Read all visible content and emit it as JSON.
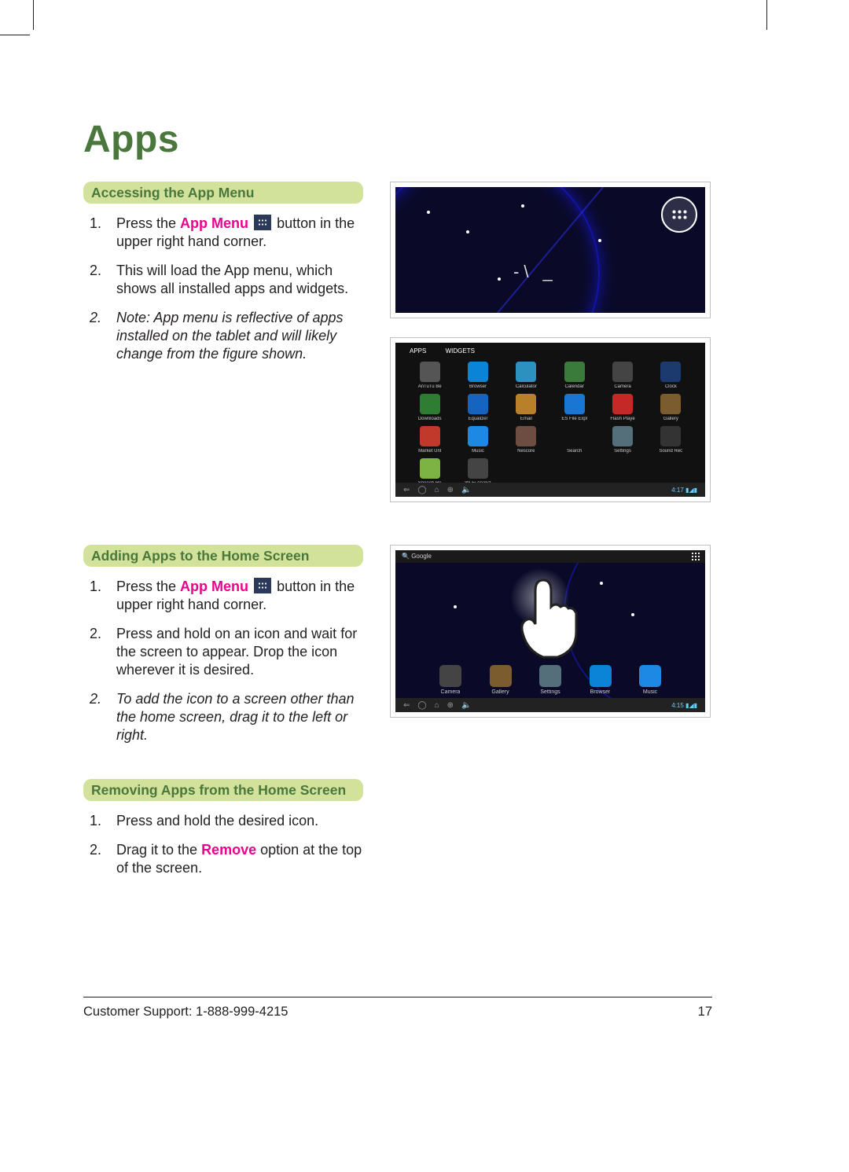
{
  "page": {
    "title": "Apps",
    "number": "17",
    "footer": "Customer Support: 1-888-999-4215"
  },
  "sections": {
    "accessing": {
      "heading": "Accessing the App Menu",
      "step1_a": "Press the ",
      "step1_b": "App Menu",
      "step1_c": " button in the upper right hand corner.",
      "step2": "This will load the App menu, which shows all installed apps and widgets.",
      "note": "Note: App menu is reflective of apps installed on the tablet and will likely change from the figure shown."
    },
    "adding": {
      "heading": "Adding Apps to the Home Screen",
      "step1_a": "Press the ",
      "step1_b": "App Menu",
      "step1_c": " button in the upper right hand corner.",
      "step2": "Press and hold on an icon and wait for the screen to appear. Drop the icon wherever it is desired.",
      "note": "To add the icon to a screen other than the home screen, drag it to the left or right."
    },
    "removing": {
      "heading": "Removing Apps from the Home Screen",
      "step1": "Press and hold the desired icon.",
      "step2_a": "Drag it to the ",
      "step2_b": "Remove",
      "step2_c": " option at the top of the screen."
    }
  },
  "screenshots": {
    "s2": {
      "tab1": "APPS",
      "tab2": "WIDGETS",
      "time": "4:17",
      "apps": [
        {
          "label": "AnTuTu Be",
          "color": "#555"
        },
        {
          "label": "Browser",
          "color": "#0b84d8"
        },
        {
          "label": "Calculator",
          "color": "#2d91c0"
        },
        {
          "label": "Calendar",
          "color": "#3a7a3a"
        },
        {
          "label": "Camera",
          "color": "#444"
        },
        {
          "label": "Clock",
          "color": "#1c3a6e"
        },
        {
          "label": "Downloads",
          "color": "#2e7d32"
        },
        {
          "label": "Equalizer",
          "color": "#1565c0"
        },
        {
          "label": "Email",
          "color": "#b9802a"
        },
        {
          "label": "ES File Expl",
          "color": "#1976d2"
        },
        {
          "label": "Flash Playe",
          "color": "#c62828"
        },
        {
          "label": "Gallery",
          "color": "#7a5c2e"
        },
        {
          "label": "Market Unl",
          "color": "#c0392b"
        },
        {
          "label": "Music",
          "color": "#1e88e5"
        },
        {
          "label": "Nescore",
          "color": "#6d4c41"
        },
        {
          "label": "Search",
          "color": "#111"
        },
        {
          "label": "Settings",
          "color": "#546e7a"
        },
        {
          "label": "Sound Rec",
          "color": "#333"
        },
        {
          "label": "Speech Re",
          "color": "#7cb342"
        },
        {
          "label": "Wi-Fi Analyz",
          "color": "#444"
        }
      ]
    },
    "s3": {
      "search": "Google",
      "time": "4:15",
      "dock": [
        {
          "label": "Camera",
          "color": "#444"
        },
        {
          "label": "Gallery",
          "color": "#7a5c2e"
        },
        {
          "label": "Settings",
          "color": "#546e7a"
        },
        {
          "label": "Browser",
          "color": "#0b84d8"
        },
        {
          "label": "Music",
          "color": "#1e88e5"
        }
      ]
    }
  }
}
